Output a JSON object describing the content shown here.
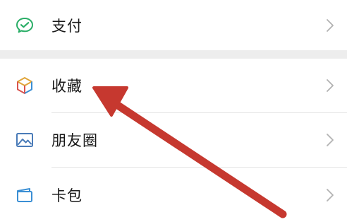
{
  "menu": {
    "items": [
      {
        "id": "pay",
        "label": "支付",
        "icon": "wechat-pay-icon"
      },
      {
        "id": "favorites",
        "label": "收藏",
        "icon": "cube-icon"
      },
      {
        "id": "moments",
        "label": "朋友圈",
        "icon": "picture-icon"
      },
      {
        "id": "card-wallet",
        "label": "卡包",
        "icon": "wallet-icon"
      }
    ],
    "chevron_icon": "chevron-right-icon"
  },
  "annotation": {
    "type": "arrow",
    "points_to": "favorites",
    "color": "#c6382f"
  },
  "colors": {
    "page_background": "#ededed",
    "row_background": "#ffffff",
    "label_text": "#191919",
    "divider": "#e5e5e5",
    "chevron": "#b2b2b2",
    "pay_green": "#2aae67",
    "moments_blue": "#4a7bb8",
    "wallet_blue": "#3b8fd4"
  }
}
